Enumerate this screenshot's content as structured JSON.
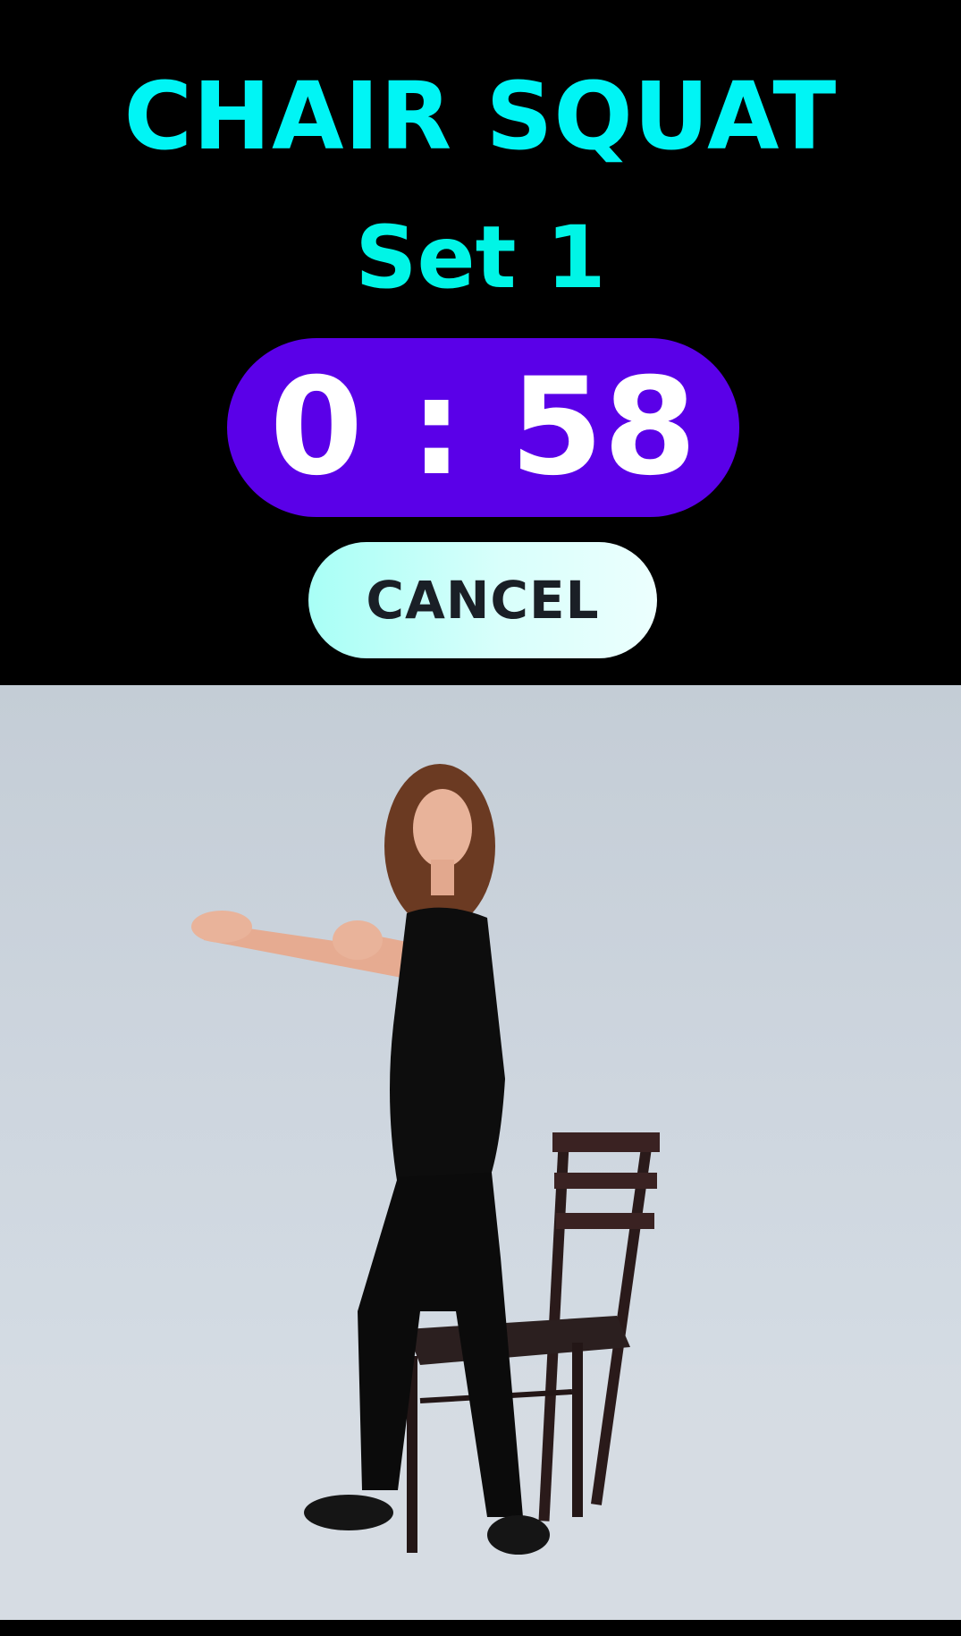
{
  "exercise": {
    "name": "CHAIR SQUAT",
    "set_label": "Set 1"
  },
  "timer": {
    "display": "0 : 58"
  },
  "actions": {
    "cancel_label": "CANCEL"
  },
  "colors": {
    "title": "#00f5f5",
    "timer_pill": "#5a00e8",
    "cancel_button": "#bffff8"
  }
}
